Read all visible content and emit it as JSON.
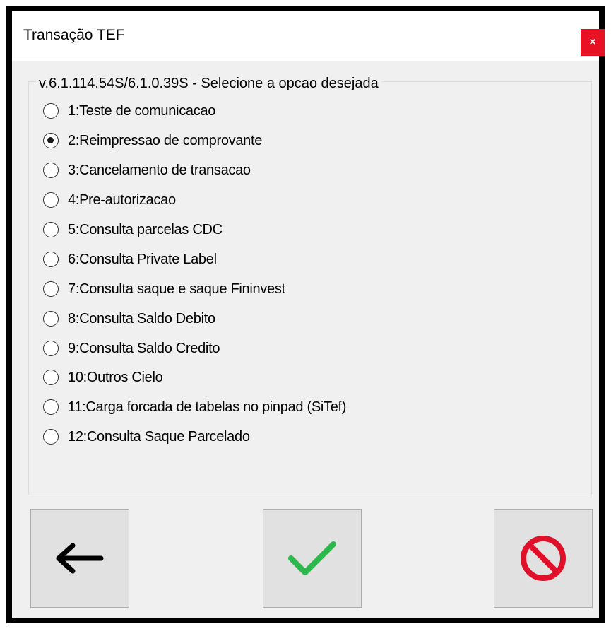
{
  "window": {
    "title": "Transação TEF",
    "close_label": "×"
  },
  "group": {
    "legend": "v.6.1.114.54S/6.1.0.39S - Selecione a opcao desejada"
  },
  "options": [
    {
      "label": "1:Teste de comunicacao",
      "selected": false
    },
    {
      "label": "2:Reimpressao de comprovante",
      "selected": true
    },
    {
      "label": "3:Cancelamento de transacao",
      "selected": false
    },
    {
      "label": "4:Pre-autorizacao",
      "selected": false
    },
    {
      "label": "5:Consulta parcelas CDC",
      "selected": false
    },
    {
      "label": "6:Consulta Private Label",
      "selected": false
    },
    {
      "label": "7:Consulta saque e saque Fininvest",
      "selected": false
    },
    {
      "label": "8:Consulta Saldo Debito",
      "selected": false
    },
    {
      "label": "9:Consulta Saldo Credito",
      "selected": false
    },
    {
      "label": "10:Outros Cielo",
      "selected": false
    },
    {
      "label": "11:Carga forcada de tabelas no pinpad (SiTef)",
      "selected": false
    },
    {
      "label": "12:Consulta Saque Parcelado",
      "selected": false
    }
  ],
  "buttons": {
    "back": {
      "icon": "arrow-left-icon",
      "color": "#000000"
    },
    "confirm": {
      "icon": "checkmark-icon",
      "color": "#2db84d"
    },
    "cancel": {
      "icon": "prohibited-icon",
      "color": "#e0102a"
    }
  }
}
